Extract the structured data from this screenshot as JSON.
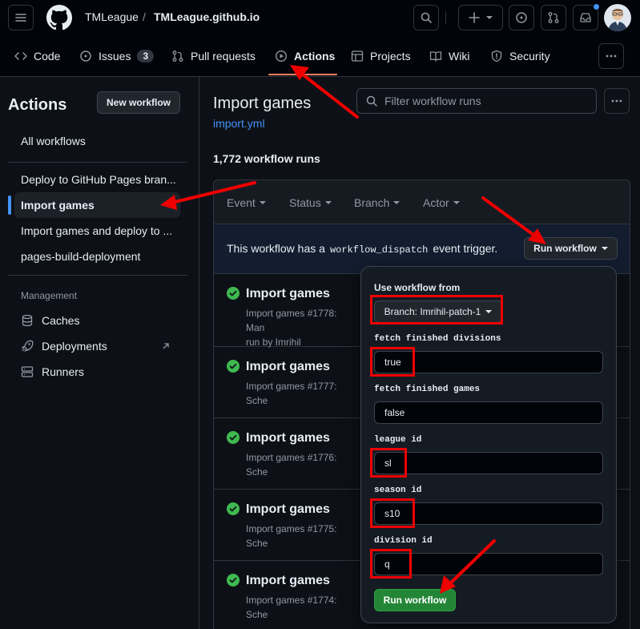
{
  "header": {
    "owner": "TMLeague",
    "separator": "/",
    "repo": "TMLeague.github.io"
  },
  "tabs": [
    {
      "label": "Code"
    },
    {
      "label": "Issues",
      "count": "3"
    },
    {
      "label": "Pull requests"
    },
    {
      "label": "Actions"
    },
    {
      "label": "Projects"
    },
    {
      "label": "Wiki"
    },
    {
      "label": "Security"
    }
  ],
  "sidebar": {
    "title": "Actions",
    "new_workflow_label": "New workflow",
    "all_workflows": "All workflows",
    "workflows": [
      "Deploy to GitHub Pages bran...",
      "Import games",
      "Import games and deploy to ...",
      "pages-build-deployment"
    ],
    "management_heading": "Management",
    "management_items": [
      "Caches",
      "Deployments",
      "Runners"
    ]
  },
  "main": {
    "title": "Import games",
    "file_link": "import.yml",
    "search_placeholder": "Filter workflow runs",
    "runs_count": "1,772 workflow runs",
    "filters": [
      "Event",
      "Status",
      "Branch",
      "Actor"
    ],
    "banner_text_before": "This workflow has a",
    "banner_code": "workflow_dispatch",
    "banner_text_after": "event trigger.",
    "run_workflow_button": "Run workflow",
    "runs": [
      {
        "title": "Import games",
        "meta": "Import games #1778: Man",
        "meta2": "run by Imrihil"
      },
      {
        "title": "Import games",
        "meta": "Import games #1777: Sche",
        "meta2": ""
      },
      {
        "title": "Import games",
        "meta": "Import games #1776: Sche",
        "meta2": ""
      },
      {
        "title": "Import games",
        "meta": "Import games #1775: Sche",
        "meta2": ""
      },
      {
        "title": "Import games",
        "meta": "Import games #1774: Sche",
        "meta2": ""
      }
    ]
  },
  "panel": {
    "use_from_label": "Use workflow from",
    "branch_button": "Branch: Imrihil-patch-1",
    "fields": [
      {
        "label": "fetch finished divisions",
        "value": "true"
      },
      {
        "label": "fetch finished games",
        "value": "false"
      },
      {
        "label": "league id",
        "value": "sl"
      },
      {
        "label": "season id",
        "value": "s10"
      },
      {
        "label": "division id",
        "value": "q"
      }
    ],
    "submit_label": "Run workflow"
  },
  "colors": {
    "accent_link": "#4493f8",
    "success": "#3fb950",
    "run_button_green": "#238636",
    "annotation_red": "#e00000"
  }
}
